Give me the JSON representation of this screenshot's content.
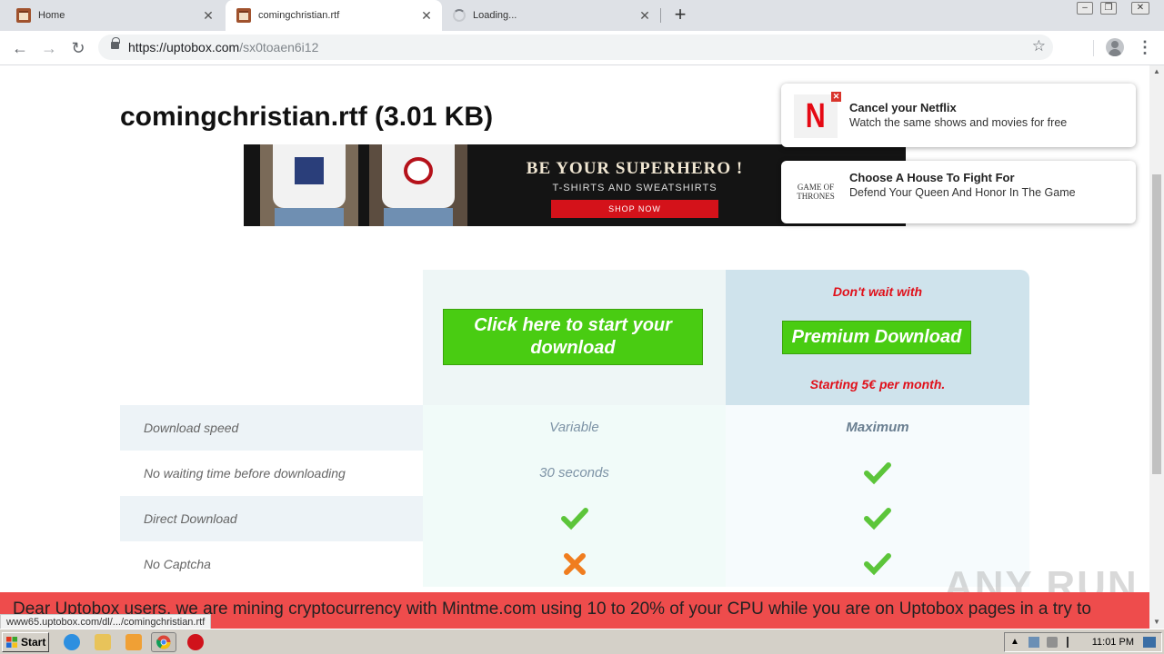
{
  "browser": {
    "tabs": [
      {
        "title": "Home"
      },
      {
        "title": "comingchristian.rtf"
      },
      {
        "title": "Loading..."
      }
    ],
    "url_host": "https://uptobox.com",
    "url_path": "/sx0toaen6i12",
    "status_url": "www65.uptobox.com/dl/.../comingchristian.rtf"
  },
  "page": {
    "file_title": "comingchristian.rtf (3.01 KB)",
    "banner": {
      "headline": "BE YOUR SUPERHERO !",
      "subline": "T-SHIRTS AND SWEATSHIRTS",
      "button": "SHOP NOW"
    },
    "notifications": [
      {
        "title": "Cancel your Netflix",
        "body": "Watch the same shows and movies for free",
        "logo_letter": "N"
      },
      {
        "title": "Choose A House To Fight For",
        "body": "Defend Your Queen And Honor In The Game",
        "logo_text": "GAME OF THRONES"
      }
    ],
    "free": {
      "button": "Click here to start your download"
    },
    "premium": {
      "tagline": "Don't wait with",
      "button": "Premium Download",
      "price": "Starting 5€ per month."
    },
    "rows": [
      {
        "label": "Download speed",
        "free": "Variable",
        "premium": "Maximum"
      },
      {
        "label": "No waiting time before downloading",
        "free": "30 seconds",
        "premium": "check"
      },
      {
        "label": "Direct Download",
        "free": "check",
        "premium": "check"
      },
      {
        "label": "No Captcha",
        "free": "cross",
        "premium": "check"
      }
    ],
    "notice": "Dear Uptobox users, we are mining cryptocurrency with Mintme.com using 10 to 20% of your CPU while you are on Uptobox pages in a try to"
  },
  "watermark": "ANY RUN",
  "taskbar": {
    "start": "Start",
    "clock": "11:01 PM"
  },
  "colors": {
    "green_button": "#49cc12",
    "premium_red": "#e0101a",
    "notice_red": "#ee4c4c",
    "check_green": "#5cc53a",
    "cross_orange": "#f07d1f"
  }
}
